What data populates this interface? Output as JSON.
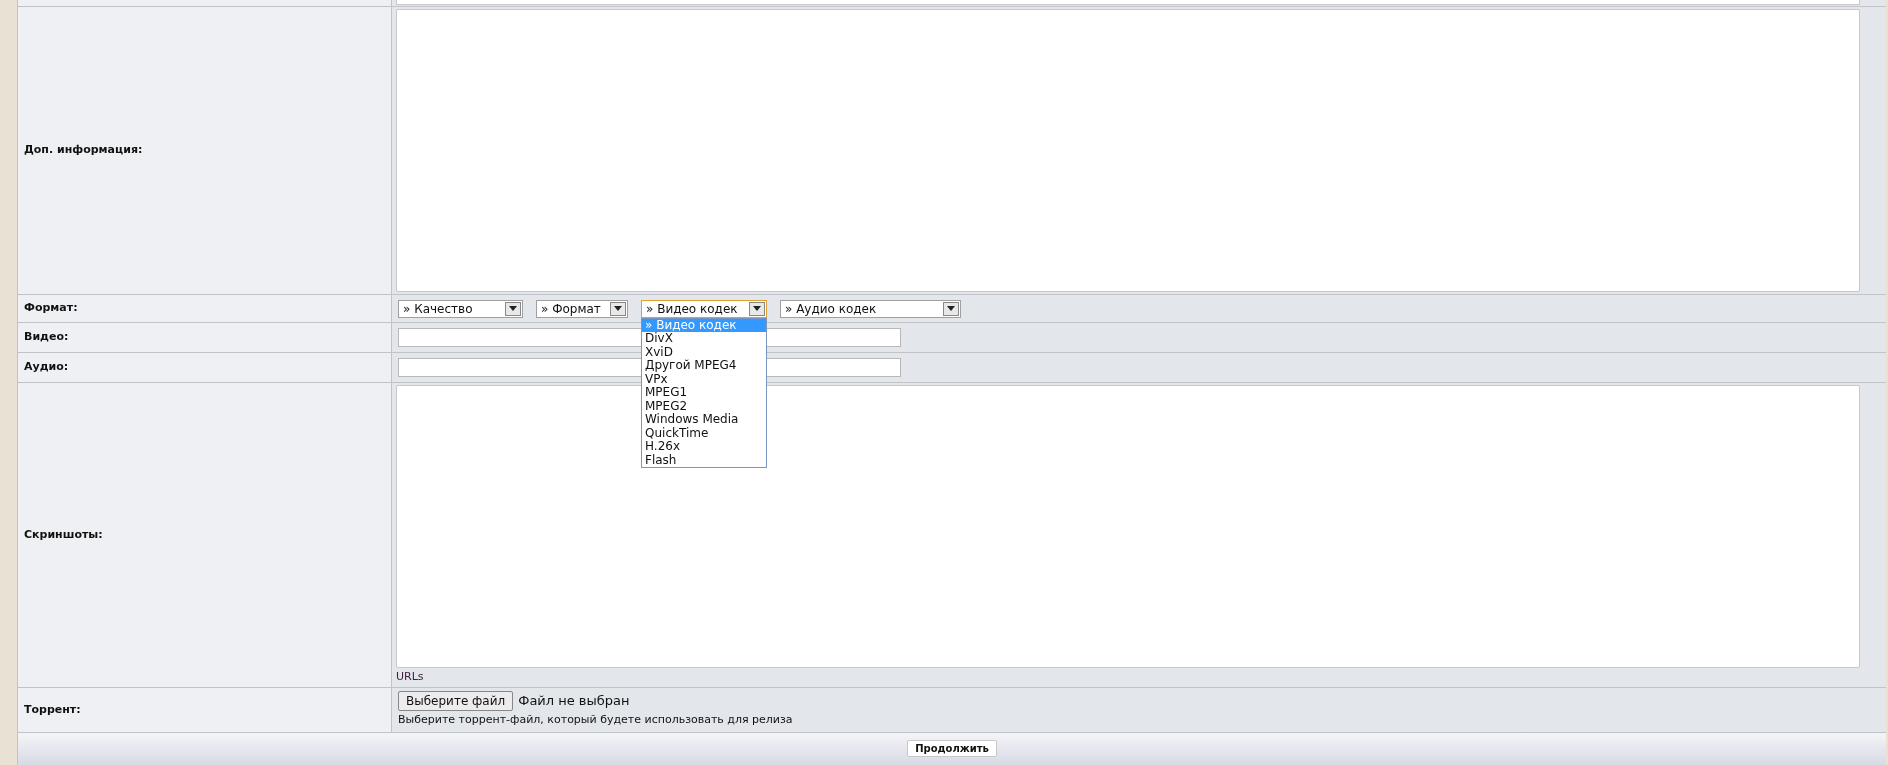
{
  "rows": [
    {
      "kind": "textarea",
      "label": "Доп. информация:"
    },
    {
      "kind": "selects",
      "label": "Формат:",
      "selects": [
        {
          "value": "» Качество",
          "expanded": false
        },
        {
          "value": "» Формат",
          "expanded": false
        },
        {
          "value": "» Видео кодек",
          "expanded": true,
          "options": [
            {
              "label": "» Видео кодек",
              "selected": true
            },
            {
              "label": "DivX",
              "selected": false
            },
            {
              "label": "XviD",
              "selected": false
            },
            {
              "label": "Другой MPEG4",
              "selected": false
            },
            {
              "label": "VPx",
              "selected": false
            },
            {
              "label": "MPEG1",
              "selected": false
            },
            {
              "label": "MPEG2",
              "selected": false
            },
            {
              "label": "Windows Media",
              "selected": false
            },
            {
              "label": "QuickTime",
              "selected": false
            },
            {
              "label": "H.26x",
              "selected": false
            },
            {
              "label": "Flash",
              "selected": false
            }
          ]
        },
        {
          "value": "» Аудио кодек",
          "expanded": false
        }
      ]
    },
    {
      "kind": "text",
      "label": "Видео:"
    },
    {
      "kind": "text",
      "label": "Аудио:"
    },
    {
      "kind": "textarea",
      "label": "Скриншоты:",
      "note": "URLs"
    },
    {
      "kind": "file",
      "label": "Торрент:",
      "button": "Выберите файл",
      "status": "Файл не выбран",
      "hint": "Выберите торрент-файл, который будете использовать для релиза"
    }
  ],
  "submit": "Продолжить"
}
